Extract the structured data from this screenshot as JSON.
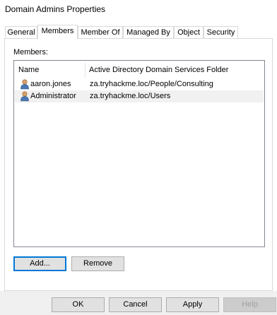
{
  "window": {
    "title": "Domain Admins Properties"
  },
  "tabs": [
    {
      "label": "General",
      "active": false
    },
    {
      "label": "Members",
      "active": true
    },
    {
      "label": "Member Of",
      "active": false
    },
    {
      "label": "Managed By",
      "active": false
    },
    {
      "label": "Object",
      "active": false
    },
    {
      "label": "Security",
      "active": false
    }
  ],
  "members": {
    "label": "Members:",
    "columns": [
      "Name",
      "Active Directory Domain Services Folder"
    ],
    "rows": [
      {
        "name": "aaron.jones",
        "folder": "za.tryhackme.loc/People/Consulting",
        "icon": "user-icon"
      },
      {
        "name": "Administrator",
        "folder": "za.tryhackme.loc/Users",
        "icon": "user-icon"
      }
    ],
    "add_label": "Add...",
    "remove_label": "Remove"
  },
  "footer": {
    "ok_label": "OK",
    "cancel_label": "Cancel",
    "apply_label": "Apply",
    "help_label": "Help"
  },
  "colors": {
    "selection": "#f1f1f1",
    "default_button_border": "#0078d7",
    "dialog_footer": "#f0f0f0"
  }
}
